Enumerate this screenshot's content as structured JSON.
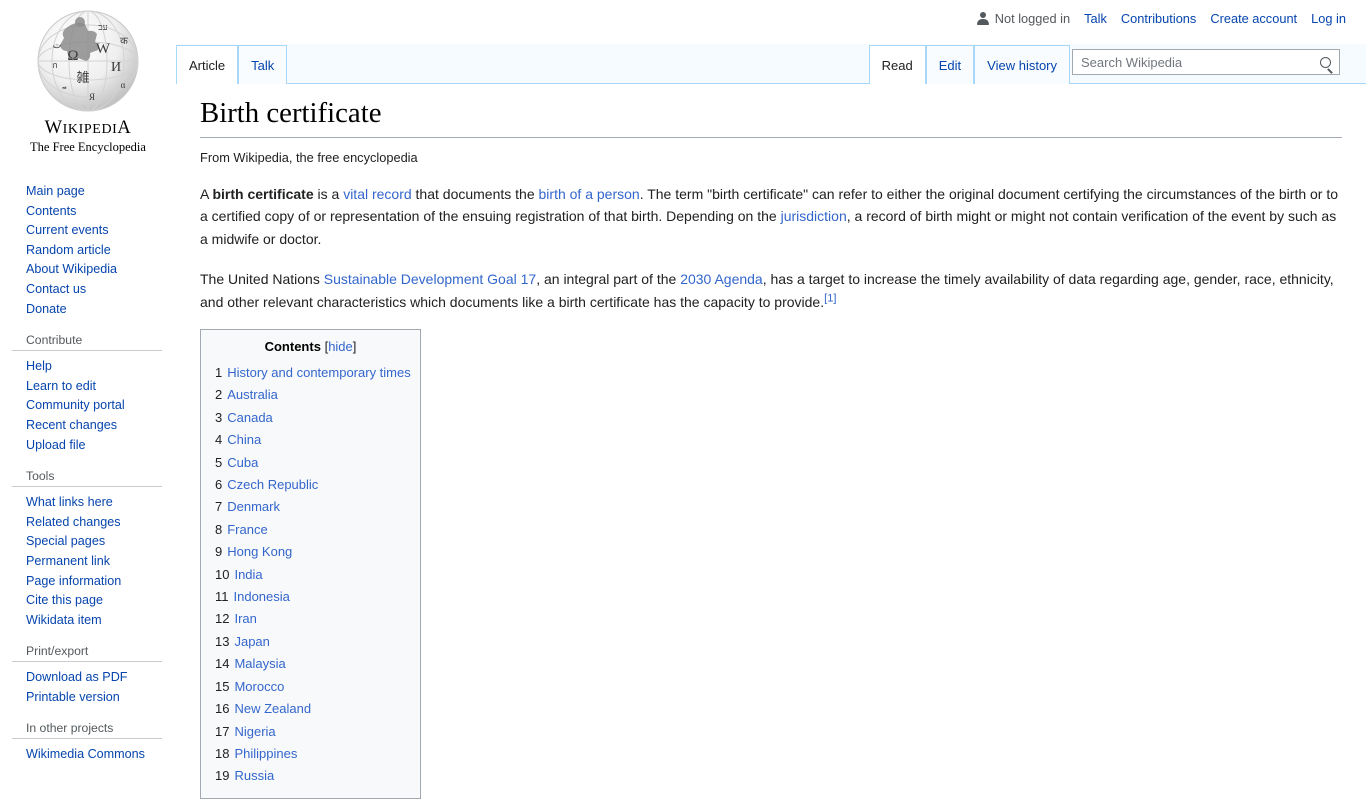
{
  "personal_bar": {
    "user_icon": "user-icon",
    "status": "Not logged in",
    "links": [
      {
        "label": "Talk"
      },
      {
        "label": "Contributions"
      },
      {
        "label": "Create account"
      },
      {
        "label": "Log in"
      }
    ]
  },
  "logo": {
    "wordmark_first": "W",
    "wordmark_rest": "IKIPEDI",
    "wordmark_last": "A",
    "wordmark_full": "WIKIPEDIA",
    "tagline": "The Free Encyclopedia"
  },
  "sidebar": {
    "navigation": {
      "items": [
        {
          "label": "Main page"
        },
        {
          "label": "Contents"
        },
        {
          "label": "Current events"
        },
        {
          "label": "Random article"
        },
        {
          "label": "About Wikipedia"
        },
        {
          "label": "Contact us"
        },
        {
          "label": "Donate"
        }
      ]
    },
    "contribute": {
      "heading": "Contribute",
      "items": [
        {
          "label": "Help"
        },
        {
          "label": "Learn to edit"
        },
        {
          "label": "Community portal"
        },
        {
          "label": "Recent changes"
        },
        {
          "label": "Upload file"
        }
      ]
    },
    "tools": {
      "heading": "Tools",
      "items": [
        {
          "label": "What links here"
        },
        {
          "label": "Related changes"
        },
        {
          "label": "Special pages"
        },
        {
          "label": "Permanent link"
        },
        {
          "label": "Page information"
        },
        {
          "label": "Cite this page"
        },
        {
          "label": "Wikidata item"
        }
      ]
    },
    "print_export": {
      "heading": "Print/export",
      "items": [
        {
          "label": "Download as PDF"
        },
        {
          "label": "Printable version"
        }
      ]
    },
    "other_projects": {
      "heading": "In other projects",
      "items": [
        {
          "label": "Wikimedia Commons"
        }
      ]
    }
  },
  "namespace_tabs": [
    {
      "label": "Article",
      "selected": true
    },
    {
      "label": "Talk",
      "selected": false
    }
  ],
  "view_tabs": [
    {
      "label": "Read",
      "selected": true
    },
    {
      "label": "Edit",
      "selected": false
    },
    {
      "label": "View history",
      "selected": false
    }
  ],
  "search": {
    "placeholder": "Search Wikipedia",
    "value": "",
    "icon": "search-icon"
  },
  "article": {
    "title": "Birth certificate",
    "site_sub": "From Wikipedia, the free encyclopedia",
    "paragraph1": {
      "t1": "A ",
      "bold": "birth certificate",
      "t2": " is a ",
      "link1": "vital record",
      "t3": " that documents the ",
      "link2": "birth of a person",
      "t4": ". The term \"birth certificate\" can refer to either the original document certifying the circumstances of the birth or to a certified copy of or representation of the ensuing registration of that birth. Depending on the ",
      "link3": "jurisdiction",
      "t5": ", a record of birth might or might not contain verification of the event by such as a midwife or doctor."
    },
    "paragraph2": {
      "t1": "The United Nations ",
      "link1": "Sustainable Development Goal 17",
      "t2": ", an integral part of the ",
      "link2": "2030 Agenda",
      "t3": ", has a target to increase the timely availability of data regarding age, gender, race, ethnicity, and other relevant characteristics which documents like a birth certificate has the capacity to provide.",
      "ref": "[1]"
    }
  },
  "toc": {
    "heading": "Contents",
    "bracket_open": "[",
    "toggle": "hide",
    "bracket_close": "]",
    "entries": [
      {
        "number": "1",
        "label": "History and contemporary times"
      },
      {
        "number": "2",
        "label": "Australia"
      },
      {
        "number": "3",
        "label": "Canada"
      },
      {
        "number": "4",
        "label": "China"
      },
      {
        "number": "5",
        "label": "Cuba"
      },
      {
        "number": "6",
        "label": "Czech Republic"
      },
      {
        "number": "7",
        "label": "Denmark"
      },
      {
        "number": "8",
        "label": "France"
      },
      {
        "number": "9",
        "label": "Hong Kong"
      },
      {
        "number": "10",
        "label": "India"
      },
      {
        "number": "11",
        "label": "Indonesia"
      },
      {
        "number": "12",
        "label": "Iran"
      },
      {
        "number": "13",
        "label": "Japan"
      },
      {
        "number": "14",
        "label": "Malaysia"
      },
      {
        "number": "15",
        "label": "Morocco"
      },
      {
        "number": "16",
        "label": "New Zealand"
      },
      {
        "number": "17",
        "label": "Nigeria"
      },
      {
        "number": "18",
        "label": "Philippines"
      },
      {
        "number": "19",
        "label": "Russia"
      }
    ]
  },
  "colors": {
    "link": "#3366cc",
    "sidebar_link": "#0645ad",
    "tab_border": "#a7d7f9",
    "rule": "#a2a9b1",
    "toc_bg": "#f8f9fa",
    "muted_text": "#54595d"
  }
}
